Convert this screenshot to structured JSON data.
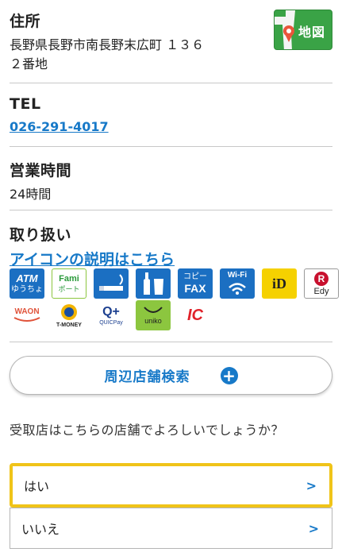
{
  "address": {
    "label": "住所",
    "line1": "長野県長野市南長野末広町 １３６",
    "line2": "２番地",
    "map_button": "地図"
  },
  "tel": {
    "label": "TEL",
    "number": "026-291-4017"
  },
  "hours": {
    "label": "営業時間",
    "value": "24時間"
  },
  "services": {
    "label": "取り扱い",
    "icon_link": "アイコンの説明はこちら",
    "row1": [
      {
        "name": "atm-icon",
        "text": "ATM",
        "sub": "ゆうちょ"
      },
      {
        "name": "famiport-icon",
        "text": "Fami",
        "sub": "ポート"
      },
      {
        "name": "cigarette-icon"
      },
      {
        "name": "liquor-icon"
      },
      {
        "name": "copy-fax-icon",
        "text": "コピー",
        "sub": "FAX"
      },
      {
        "name": "wifi-icon",
        "text": "Wi-Fi"
      },
      {
        "name": "id-icon",
        "text": "iD"
      },
      {
        "name": "edy-icon",
        "text": "R",
        "sub": "Edy"
      }
    ],
    "row2": [
      {
        "name": "waon-icon",
        "text": "WAON"
      },
      {
        "name": "tmoney-icon",
        "text": "T-MONEY"
      },
      {
        "name": "quicpay-icon",
        "text": "Q+",
        "sub": "QUICPay"
      },
      {
        "name": "uniko-icon",
        "text": "uniko"
      },
      {
        "name": "ic-icon",
        "text": "IC"
      }
    ]
  },
  "search": {
    "label": "周辺店舗検索",
    "plus": "+"
  },
  "question": "受取店はこちらの店舗でよろしいでしょうか？",
  "choices": [
    {
      "label": "はい",
      "arrow": ">"
    },
    {
      "label": "いいえ",
      "arrow": ">"
    }
  ],
  "colors": {
    "link": "#1779c8",
    "highlight": "#f0c419",
    "map_green": "#3aa346"
  }
}
